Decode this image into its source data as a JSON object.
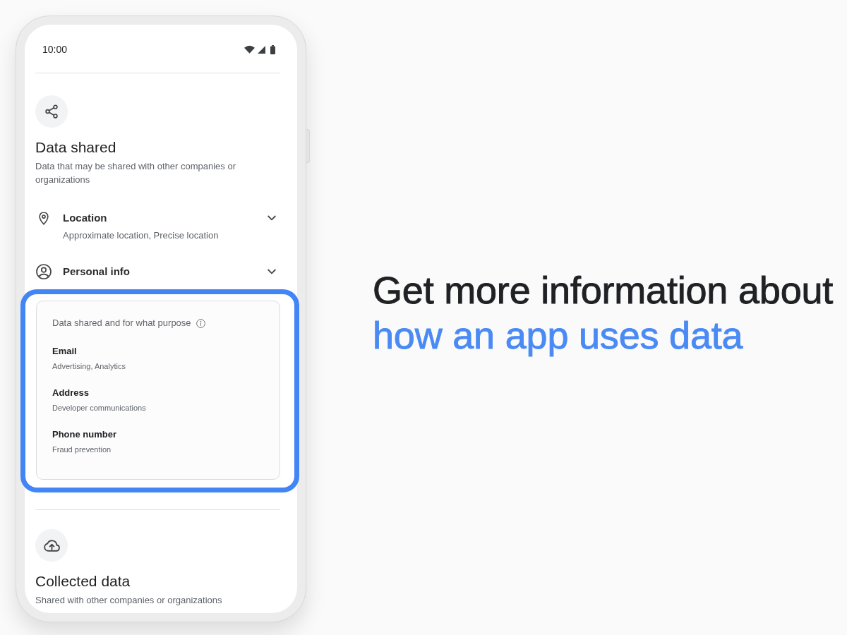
{
  "phone": {
    "status_bar": {
      "time": "10:00"
    },
    "sections": [
      {
        "kind": "shared",
        "title": "Data shared",
        "description": "Data that may be shared with other companies or organizations",
        "categories": [
          {
            "kind": "location",
            "name": "Location",
            "details": "Approximate location, Precise location"
          },
          {
            "kind": "personal_info",
            "name": "Personal info"
          }
        ],
        "purpose_card": {
          "highlighted": true,
          "title": "Data shared and for what purpose",
          "items": [
            {
              "name": "Email",
              "purposes": "Advertising, Analytics"
            },
            {
              "name": "Address",
              "purposes": "Developer communications"
            },
            {
              "name": "Phone number",
              "purposes": "Fraud prevention"
            }
          ]
        }
      },
      {
        "kind": "collected",
        "title": "Collected data",
        "description": "Shared with other companies or organizations"
      }
    ]
  },
  "headline": {
    "text": "Get more information about",
    "accent": "how an app uses data"
  }
}
